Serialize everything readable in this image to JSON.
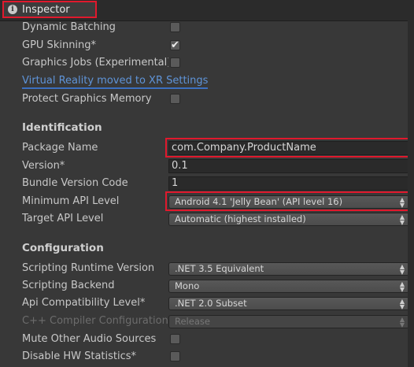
{
  "tab": {
    "icon": "info-icon",
    "title": "Inspector"
  },
  "rows_top": [
    {
      "label": "Dynamic Batching",
      "checked": false
    },
    {
      "label": "GPU Skinning*",
      "checked": true
    },
    {
      "label": "Graphics Jobs (Experimental)",
      "checked": false
    }
  ],
  "link": "Virtual Reality moved to XR Settings",
  "protect": {
    "label": "Protect Graphics Memory",
    "checked": false
  },
  "identification": {
    "header": "Identification",
    "package_name_label": "Package Name",
    "package_name_value": "com.Company.ProductName",
    "version_label": "Version*",
    "version_value": "0.1",
    "bundle_label": "Bundle Version Code",
    "bundle_value": "1",
    "min_api_label": "Minimum API Level",
    "min_api_value": "Android 4.1 'Jelly Bean' (API level 16)",
    "target_api_label": "Target API Level",
    "target_api_value": "Automatic (highest installed)"
  },
  "configuration": {
    "header": "Configuration",
    "runtime_label": "Scripting Runtime Version",
    "runtime_value": ".NET 3.5 Equivalent",
    "backend_label": "Scripting Backend",
    "backend_value": "Mono",
    "api_compat_label": "Api Compatibility Level*",
    "api_compat_value": ".NET 2.0 Subset",
    "cpp_label": "C++ Compiler Configuration",
    "cpp_value": "Release",
    "mute_label": "Mute Other Audio Sources",
    "mute_checked": false,
    "hw_label": "Disable HW Statistics*",
    "hw_checked": false
  },
  "colors": {
    "highlight": "#e0192d",
    "link": "#5f94d8",
    "panel": "#383838"
  }
}
